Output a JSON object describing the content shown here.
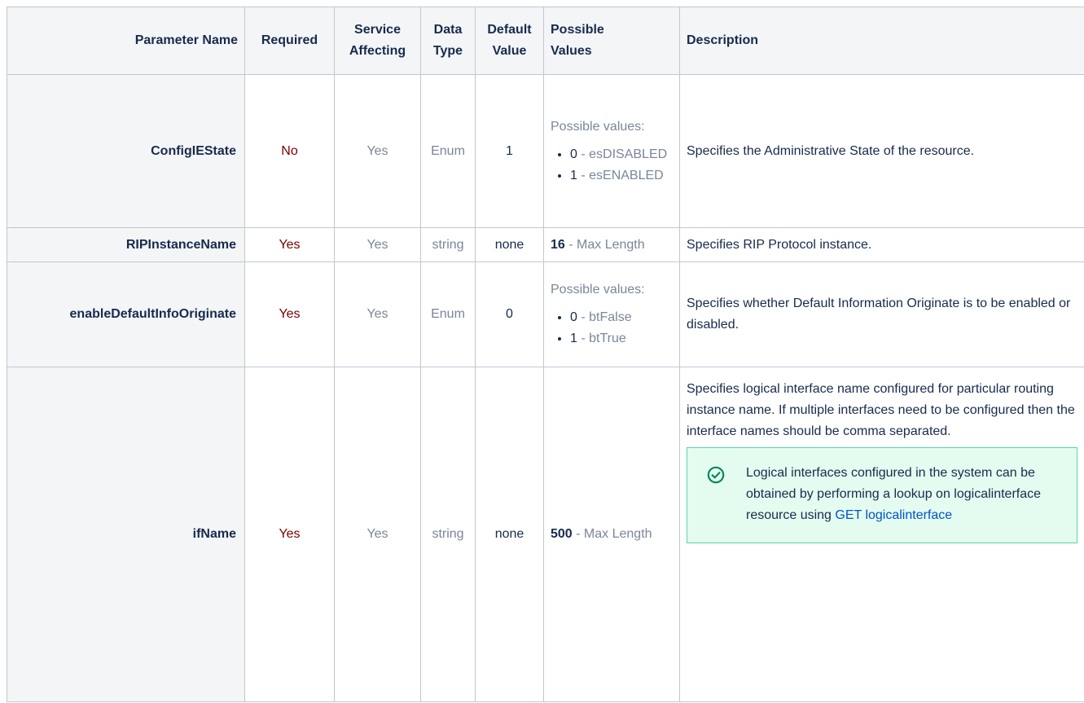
{
  "headers": {
    "name": "Parameter Name",
    "required": "Required",
    "service_affecting_1": "Service",
    "service_affecting_2": "Affecting",
    "data_type_1": "Data",
    "data_type_2": "Type",
    "default_value_1": "Default",
    "default_value_2": "Value",
    "possible_values_1": "Possible",
    "possible_values_2": "Values",
    "description": "Description"
  },
  "rows": [
    {
      "name": "ConfigIEState",
      "required": "No",
      "service_affecting": "Yes",
      "data_type": "Enum",
      "default_value": "1",
      "possible_title": "Possible values:",
      "possible": [
        {
          "num": "0",
          "sep": " - ",
          "name": "esDISABLED"
        },
        {
          "num": "1",
          "sep": " - ",
          "name": "esENABLED"
        }
      ],
      "description": "Specifies the Administrative State of the resource."
    },
    {
      "name": "RIPInstanceName",
      "required": "Yes",
      "service_affecting": "Yes",
      "data_type": "string",
      "default_value": "none",
      "length_num": "16",
      "length_unit": " - Max Length",
      "description": "Specifies RIP Protocol instance."
    },
    {
      "name": "enableDefaultInfoOriginate",
      "required": "Yes",
      "service_affecting": "Yes",
      "data_type": "Enum",
      "default_value": "0",
      "possible_title": "Possible values:",
      "possible": [
        {
          "num": "0",
          "sep": " - ",
          "name": "btFalse"
        },
        {
          "num": "1",
          "sep": " - ",
          "name": "btTrue"
        }
      ],
      "description": "Specifies whether Default Information Originate is to be enabled or disabled."
    },
    {
      "name": "ifName",
      "required": "Yes",
      "service_affecting": "Yes",
      "data_type": "string",
      "default_value": "none",
      "length_num": "500",
      "length_unit": " - Max Length",
      "description": "Specifies logical interface name configured for particular routing instance name. If multiple interfaces need to be configured then the interface names should be comma separated.",
      "info_text": "Logical interfaces configured in the system can be obtained by performing a lookup on logicalinterface resource using ",
      "info_link": "GET logicalinterface"
    }
  ],
  "colors": {
    "required_text": "#7a0000",
    "muted_text": "#7a869a",
    "header_bg": "#f4f5f7",
    "border": "#c1c7d0",
    "info_bg": "#e3fcef",
    "info_border": "#57d9a3",
    "check_icon": "#00875a",
    "link": "#0052cc"
  },
  "icons": {
    "info_box": "check-circle-icon"
  }
}
